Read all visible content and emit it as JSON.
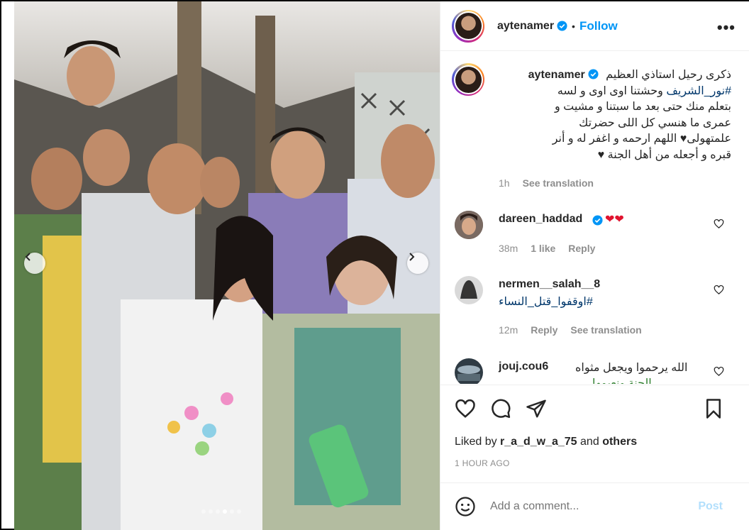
{
  "post": {
    "author": "aytenamer",
    "follow_label": "Follow",
    "separator": "•",
    "more_label": "•••",
    "caption_lines": [
      "ذكرى رحيل استاذي العظيم",
      "وحشتنا اوى اوى و لسه",
      "بتعلم منك حتى بعد ما سبتنا و مشيت و",
      "عمرى ما هنسي كل اللى حضرتك",
      "علمتهولى♥ اللهم ارحمه و اغفر له و أنر",
      "قبره و أجعله من أهل الجنة ♥"
    ],
    "caption_hashtag": "#نور_الشريف",
    "caption_time": "1h",
    "see_translation": "See translation",
    "liked_by_prefix": "Liked by",
    "liked_by_user": "r_a_d_w_a_75",
    "liked_by_and": "and",
    "liked_by_others": "others",
    "timestamp": "1 HOUR AGO",
    "add_comment_placeholder": "Add a comment...",
    "post_button": "Post"
  },
  "comments": [
    {
      "user": "dareen_haddad",
      "text": "❤❤",
      "time": "38m",
      "likes": "1 like",
      "reply": "Reply",
      "verified": true
    },
    {
      "user": "nermen__salah__8",
      "text": "#اوقفوا_قتل_النساء",
      "time": "12m",
      "reply": "Reply",
      "see_translation": "See translation"
    },
    {
      "user": "jouj.cou6",
      "text": "الله يرحموا ويجعل مثواه",
      "text2": "الجنة ونعيمها"
    }
  ],
  "carousel": {
    "slides": 6,
    "active": 3
  },
  "colors": {
    "accent": "#0095f6",
    "link": "#00376b",
    "muted": "#8e8e8e",
    "post_disabled": "#b2dffc"
  }
}
